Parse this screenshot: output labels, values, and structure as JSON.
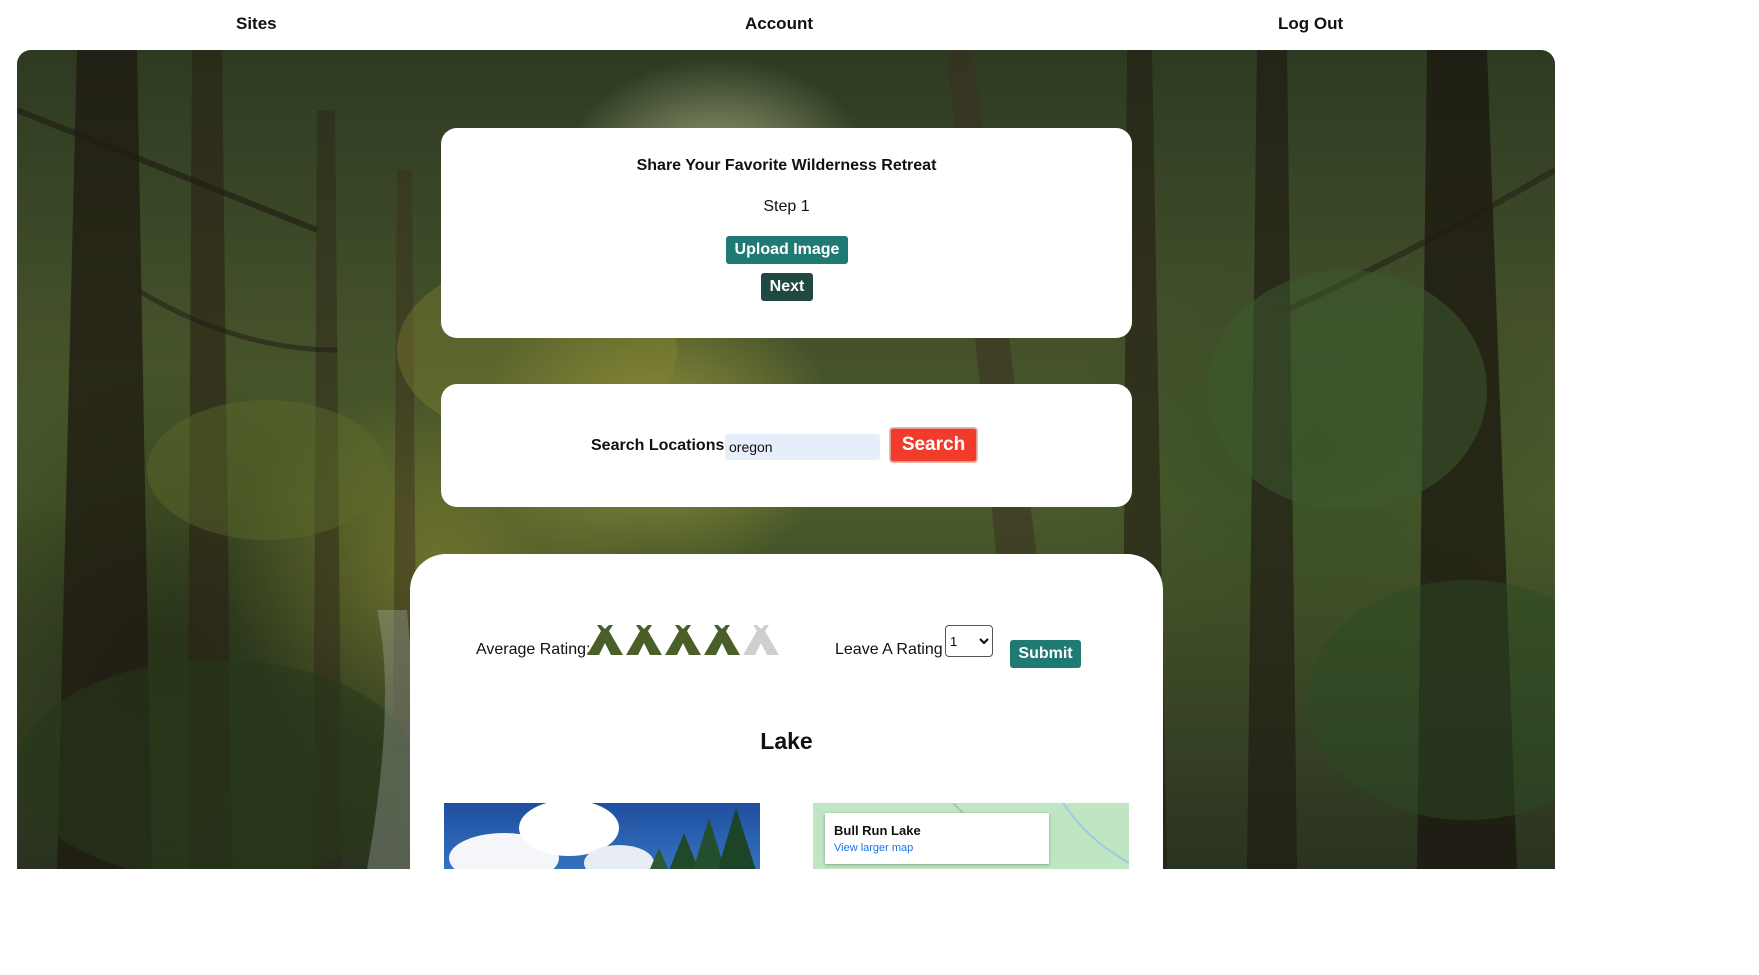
{
  "nav": {
    "sites": "Sites",
    "account": "Account",
    "logout": "Log Out"
  },
  "share": {
    "title": "Share Your Favorite Wilderness Retreat",
    "step": "Step 1",
    "upload_label": "Upload Image",
    "next_label": "Next"
  },
  "search": {
    "label": "Search Locations",
    "value": "oregon",
    "button_label": "Search"
  },
  "rating": {
    "average_label": "Average Rating:",
    "average_value": 4,
    "max": 5,
    "icon": "tent-icon",
    "filled_color": "#4a5e2a",
    "empty_color": "#cfcfcf",
    "leave_label": "Leave A Rating",
    "selected_option": "1",
    "submit_label": "Submit"
  },
  "site": {
    "name": "Lake",
    "map_title": "Bull Run Lake",
    "map_link": "View larger map"
  },
  "colors": {
    "teal_button": "#1f7a74",
    "dark_button": "#224844",
    "search_button": "#f13c2c"
  }
}
